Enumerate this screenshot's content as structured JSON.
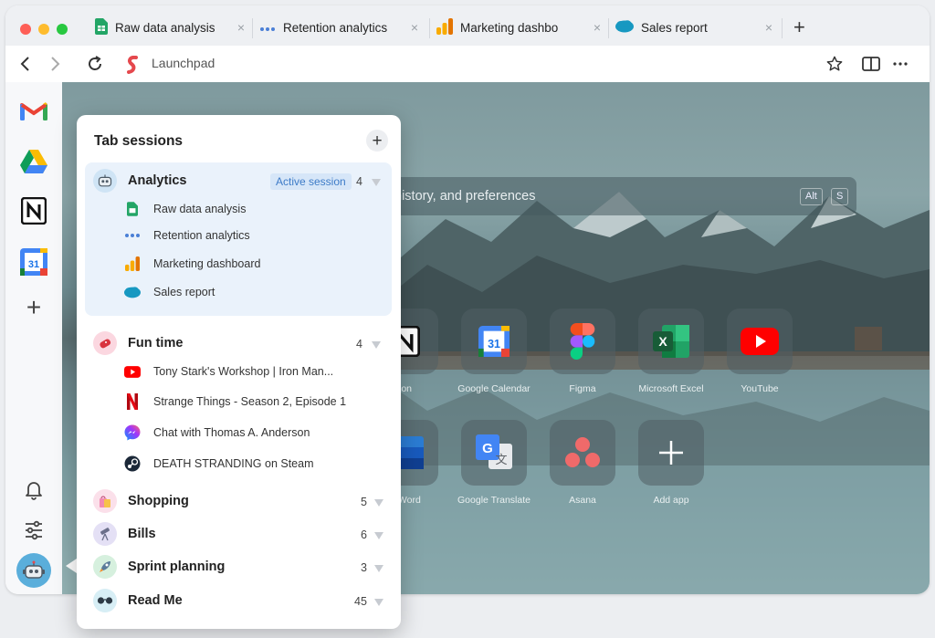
{
  "browser": {
    "tabs": [
      {
        "label": "Raw data analysis",
        "icon": "google-sheets-icon"
      },
      {
        "label": "Retention analytics",
        "icon": "dots-icon"
      },
      {
        "label": "Marketing dashbo",
        "icon": "analytics-bar-icon"
      },
      {
        "label": "Sales report",
        "icon": "salesforce-icon"
      }
    ],
    "close_glyph": "×",
    "new_tab_glyph": "+",
    "address": "Launchpad"
  },
  "sidebar": {
    "apps": [
      "gmail-icon",
      "google-drive-icon",
      "notion-icon",
      "google-calendar-icon"
    ],
    "calendar_day": "31",
    "add_glyph": "+"
  },
  "launchpad": {
    "search_placeholder": "history, and preferences",
    "shortcut_keys": [
      "Alt",
      "S"
    ],
    "tiles_row1": [
      {
        "label": "ion"
      },
      {
        "label": "Google Calendar"
      },
      {
        "label": "Figma"
      },
      {
        "label": "Microsoft Excel"
      },
      {
        "label": "YouTube"
      }
    ],
    "tiles_row2": [
      {
        "label": "ft Word"
      },
      {
        "label": "Google Translate"
      },
      {
        "label": "Asana"
      },
      {
        "label": "Add app"
      }
    ]
  },
  "tab_sessions": {
    "title": "Tab sessions",
    "add_glyph": "+",
    "active_badge": "Active session",
    "sessions": [
      {
        "name": "Analytics",
        "count": "4",
        "tabs": [
          "Raw data analysis",
          "Retention analytics",
          "Marketing dashboard",
          "Sales report"
        ]
      },
      {
        "name": "Fun time",
        "count": "4",
        "tabs": [
          "Tony Stark's Workshop | Iron Man...",
          "Strange Things - Season 2, Episode 1",
          "Chat with Thomas A. Anderson",
          "DEATH STRANDING on Steam"
        ]
      },
      {
        "name": "Shopping",
        "count": "5"
      },
      {
        "name": "Bills",
        "count": "6"
      },
      {
        "name": "Sprint planning",
        "count": "3"
      },
      {
        "name": "Read Me",
        "count": "45"
      }
    ]
  },
  "colors": {
    "accent": "#3d7bc7",
    "active_session_bg": "#eaf2fb"
  }
}
